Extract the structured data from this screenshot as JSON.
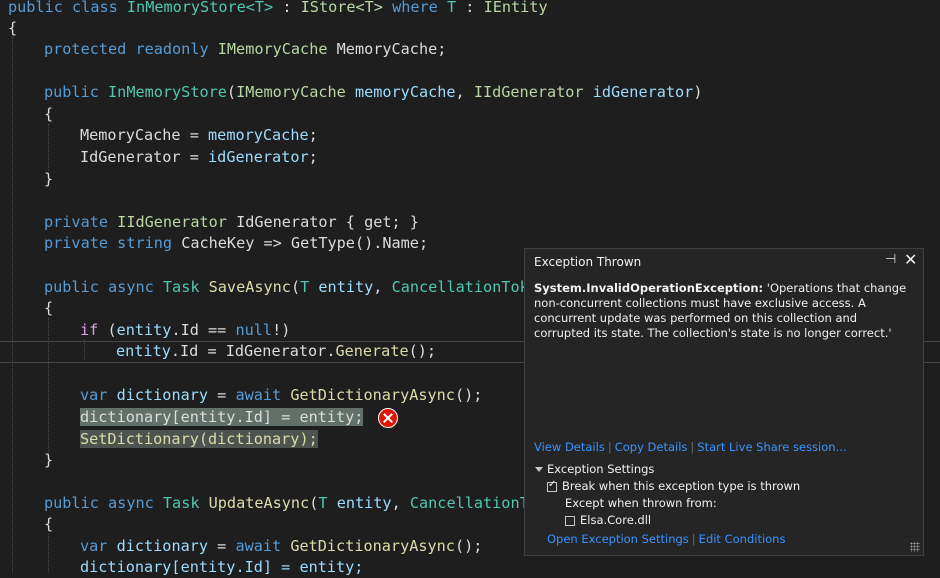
{
  "code": {
    "class_decl": {
      "kw1": "public",
      "kw2": "class",
      "name": "InMemoryStore<T>",
      "colon": " : ",
      "iface": "IStore<T>",
      "where": "where",
      "t": "T",
      "colon2": " : ",
      "ientity": "IEntity"
    },
    "brace_open": "{",
    "brace_close": "}",
    "field": {
      "kw1": "protected",
      "kw2": "readonly",
      "type": "IMemoryCache",
      "name": "MemoryCache;"
    },
    "ctor": {
      "kw": "public",
      "name": "InMemoryStore",
      "p1type": "IMemoryCache",
      "p1": "memoryCache",
      "p2type": "IIdGenerator",
      "p2": "idGenerator"
    },
    "assign1": {
      "lhs": "MemoryCache",
      "rhs": "memoryCache"
    },
    "assign2": {
      "lhs": "IdGenerator",
      "rhs": "idGenerator"
    },
    "prop1": {
      "kw": "private",
      "type": "IIdGenerator",
      "name": "IdGenerator",
      "rest": " { get; }"
    },
    "prop2": {
      "kw": "private",
      "kw2": "string",
      "name": "CacheKey",
      "rest": " => GetType().Name;"
    },
    "save": {
      "kw1": "public",
      "kw2": "async",
      "type": "Task",
      "name": "SaveAsync",
      "t": "T",
      "p": "entity",
      "ct": "CancellationTok"
    },
    "if_line": {
      "kw": "if",
      "cond1": "entity",
      "cond2": ".Id == ",
      "null": "null",
      "end": "!)"
    },
    "gen_line": {
      "lhs": "entity",
      "lhs2": ".Id = IdGenerator.",
      "fn": "Generate",
      "end": "();"
    },
    "var1": {
      "kw": "var",
      "name": "dictionary",
      "await": "await",
      "fn": "GetDictionaryAsync",
      "end": "();"
    },
    "dict_assign": "dictionary[entity.Id] = entity;",
    "set_dict": "SetDictionary(dictionary);",
    "update": {
      "kw1": "public",
      "kw2": "async",
      "type": "Task",
      "name": "UpdateAsync",
      "t": "T",
      "p": "entity",
      "ct": "CancellationT"
    },
    "var2": {
      "kw": "var",
      "name": "dictionary",
      "await": "await",
      "fn": "GetDictionaryAsync",
      "end": "();"
    },
    "last": "dictionary[entity.Id] = entity;"
  },
  "popup": {
    "title": "Exception Thrown",
    "pin_glyph": "⊣",
    "close_glyph": "✕",
    "exception_type": "System.InvalidOperationException:",
    "message": "'Operations that change non-concurrent collections must have exclusive access. A concurrent update was performed on this collection and corrupted its state. The collection's state is no longer correct.'",
    "links": [
      "View Details",
      "Copy Details",
      "Start Live Share session..."
    ],
    "settings_header": "Exception Settings",
    "break_label": "Break when this exception type is thrown",
    "except_label": "Except when thrown from:",
    "module_label": "Elsa.Core.dll",
    "links2": [
      "Open Exception Settings",
      "Edit Conditions"
    ]
  }
}
